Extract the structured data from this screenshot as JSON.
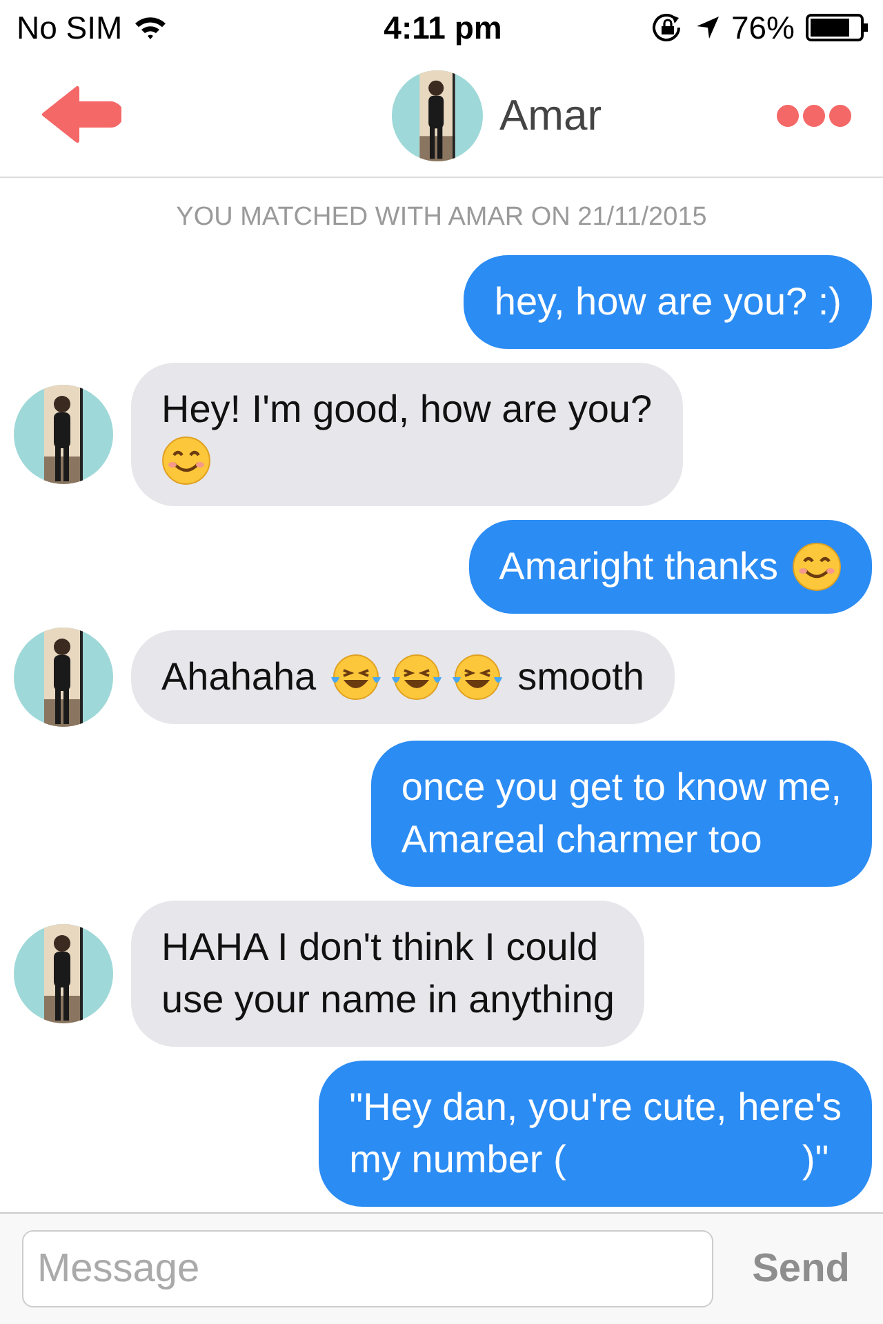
{
  "status_bar": {
    "carrier": "No SIM",
    "time": "4:11 pm",
    "battery": "76%"
  },
  "header": {
    "name": "Amar"
  },
  "match_note": "YOU MATCHED WITH AMAR ON 21/11/2015",
  "messages": [
    {
      "kind": "outgoing",
      "lines": [
        [
          {
            "kind": "text",
            "text": "hey, how are you? :)"
          }
        ]
      ]
    },
    {
      "kind": "incoming",
      "lines": [
        [
          {
            "kind": "text",
            "text": "Hey! I'm good, how are you?"
          }
        ],
        [
          {
            "kind": "smile-emoji"
          }
        ]
      ]
    },
    {
      "kind": "outgoing",
      "lines": [
        [
          {
            "kind": "text",
            "text": "Amaright thanks"
          },
          {
            "kind": "smile-emoji"
          }
        ]
      ]
    },
    {
      "kind": "incoming",
      "lines": [
        [
          {
            "kind": "text",
            "text": "Ahahaha"
          },
          {
            "kind": "tears-emoji"
          },
          {
            "kind": "tears-emoji"
          },
          {
            "kind": "tears-emoji"
          },
          {
            "kind": "text",
            "text": "smooth"
          }
        ]
      ]
    },
    {
      "kind": "outgoing",
      "lines": [
        [
          {
            "kind": "text",
            "text": "once you get to know me,"
          }
        ],
        [
          {
            "kind": "text",
            "text": "Amareal charmer too"
          }
        ]
      ]
    },
    {
      "kind": "incoming",
      "lines": [
        [
          {
            "kind": "text",
            "text": "HAHA I don't think I could"
          }
        ],
        [
          {
            "kind": "text",
            "text": "use your name in anything"
          }
        ]
      ]
    },
    {
      "kind": "outgoing",
      "lines": [
        [
          {
            "kind": "text",
            "text": "\"Hey dan, you're cute, here's"
          }
        ],
        [
          {
            "kind": "text",
            "text": "my number (                      )\""
          }
        ]
      ]
    }
  ],
  "composer": {
    "placeholder": "Message",
    "send": "Send"
  }
}
